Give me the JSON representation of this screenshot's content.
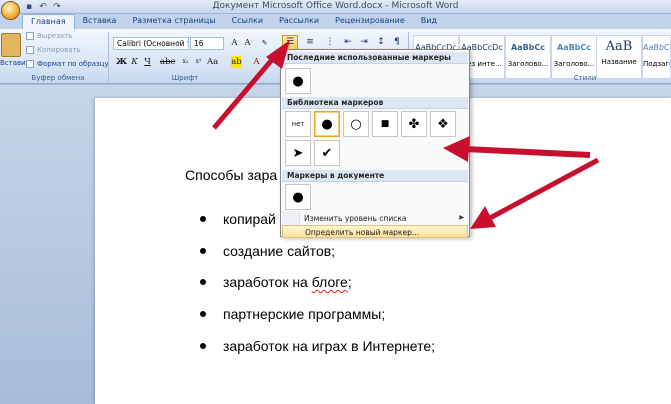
{
  "window": {
    "title": "Документ Microsoft Office Word.docx - Microsoft Word"
  },
  "tabs": [
    "Главная",
    "Вставка",
    "Разметка страницы",
    "Ссылки",
    "Рассылки",
    "Рецензирование",
    "Вид"
  ],
  "ribbon": {
    "clipboard": {
      "paste_label": "Вставить",
      "cut_label": "Вырезать",
      "copy_label": "Копировать",
      "format_painter_label": "Формат по образцу",
      "group_label": "Буфер обмена"
    },
    "font": {
      "font_name": "Calibri (Основной те",
      "font_size": "16",
      "group_label": "Шрифт"
    },
    "styles": {
      "group_label": "Стили",
      "items": [
        {
          "sample": "AaBbCcDc",
          "name": ""
        },
        {
          "sample": "AaBbCcDc",
          "name": "Без инте..."
        },
        {
          "sample": "AaBbCc",
          "name": "Заголово..."
        },
        {
          "sample": "AaBbCc",
          "name": "Заголово..."
        },
        {
          "sample": "AaB",
          "name": "Название"
        },
        {
          "sample": "AaBbCc",
          "name": "Подзагол"
        }
      ]
    }
  },
  "bullet_menu": {
    "recent_header": "Последние использованные маркеры",
    "library_header": "Библиотека маркеров",
    "document_header": "Маркеры в документе",
    "none_label": "нет",
    "change_level_label": "Изменить уровень списка",
    "define_new_label": "Определить новый маркер..."
  },
  "document": {
    "heading": "Способы зара",
    "bullets": [
      "копирай",
      "создание сайтов;",
      "заработок на блоге;",
      "партнерские программы;",
      "заработок на играх в Интернете;"
    ]
  },
  "colors": {
    "accent": "#15428b",
    "arrow": "#c8102e",
    "selection": "#ffcb52"
  }
}
